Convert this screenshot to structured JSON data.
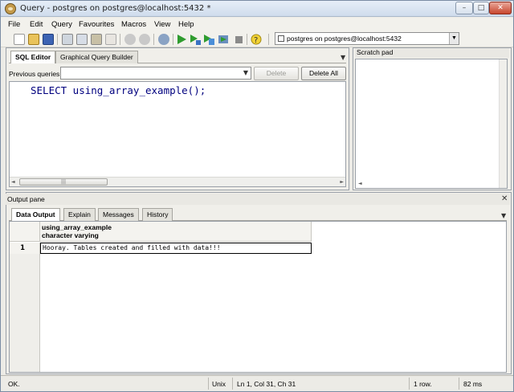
{
  "window": {
    "title": "Query - postgres on postgres@localhost:5432 *",
    "min_glyph": "–",
    "max_glyph": "□",
    "close_glyph": "✕"
  },
  "menu": [
    "File",
    "Edit",
    "Query",
    "Favourites",
    "Macros",
    "View",
    "Help"
  ],
  "toolbar": {
    "connection": "postgres on postgres@localhost:5432",
    "dropdown_glyph": "▼"
  },
  "sql_panel": {
    "tabs": [
      "SQL Editor",
      "Graphical Query Builder"
    ],
    "previous_label": "Previous queries",
    "delete_label": "Delete",
    "delete_all_label": "Delete All",
    "query": "SELECT using_array_example();",
    "scroll_grip": "|||",
    "left_arrow": "◄",
    "right_arrow": "►"
  },
  "scratch": {
    "title": "Scratch pad"
  },
  "output": {
    "title": "Output pane",
    "tabs": [
      "Data Output",
      "Explain",
      "Messages",
      "History"
    ],
    "columns": [
      {
        "name": "using_array_example",
        "type": "character varying"
      }
    ],
    "rows": [
      {
        "num": "1",
        "value": "Hooray. Tables created and filled with data!!!"
      }
    ]
  },
  "status": {
    "state": "OK.",
    "encoding": "Unix",
    "position": "Ln 1, Col 31, Ch 31",
    "rows": "1 row.",
    "time": "82 ms"
  }
}
